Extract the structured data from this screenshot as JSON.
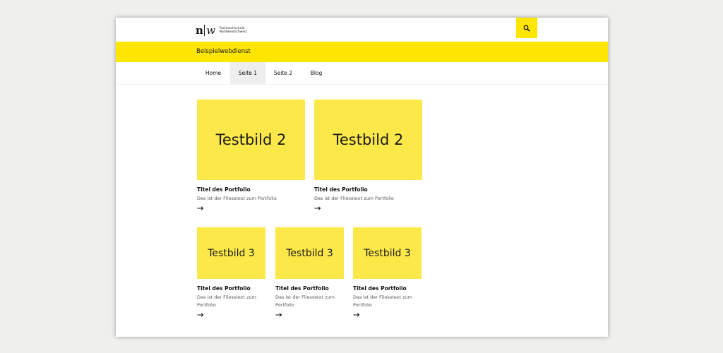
{
  "header": {
    "logo_mark_left": "n",
    "logo_mark_right": "w",
    "logo_line1": "Fachhochschule",
    "logo_line2": "Nordwestschweiz"
  },
  "service": {
    "title": "Beispielwebdienst"
  },
  "nav": {
    "items": [
      {
        "label": "Home"
      },
      {
        "label": "Seite 1",
        "active": true
      },
      {
        "label": "Seite 2"
      },
      {
        "label": "Blog"
      }
    ]
  },
  "portfolio": {
    "row1": [
      {
        "image_label": "Testbild 2",
        "title": "Titel des Portfolio",
        "text": "Das ist der Fliesstext zum Portfolio"
      },
      {
        "image_label": "Testbild 2",
        "title": "Titel des Portfolio",
        "text": "Das ist der Fliesstext zum Portfolio"
      }
    ],
    "row2": [
      {
        "image_label": "Testbild 3",
        "title": "Titel des Portfolio",
        "text": "Das ist der Fliesstext zum Portfolio"
      },
      {
        "image_label": "Testbild 3",
        "title": "Titel des Portfolio",
        "text": "Das ist der Fliesstext zum Portfolio"
      },
      {
        "image_label": "Testbild 3",
        "title": "Titel des Portfolio",
        "text": "Das ist der Fliesstext zum Portfolio"
      }
    ]
  },
  "colors": {
    "accent_yellow": "#ffe600",
    "tile_yellow": "#fde84a",
    "page_background": "#efefed"
  },
  "icons": {
    "search": "search-icon",
    "arrow": "arrow-right-icon"
  }
}
